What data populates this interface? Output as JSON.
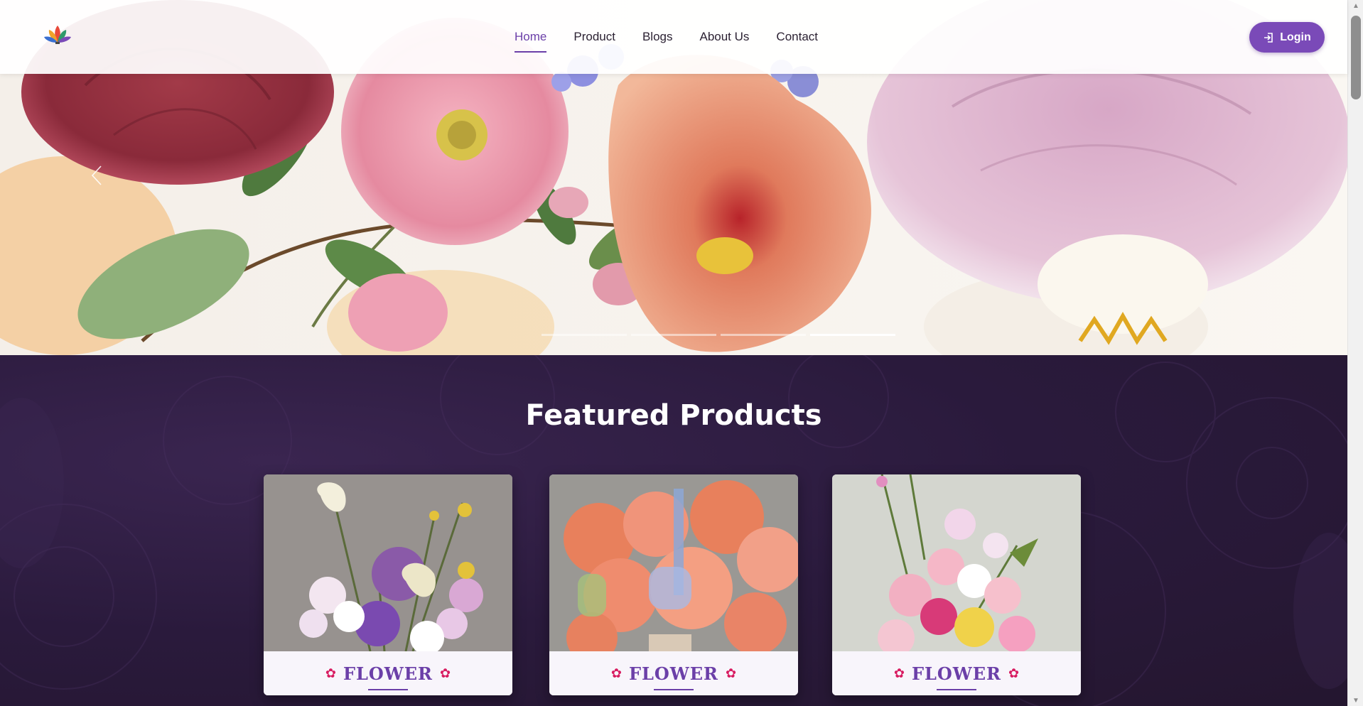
{
  "nav": {
    "items": [
      {
        "label": "Home",
        "active": true
      },
      {
        "label": "Product",
        "active": false
      },
      {
        "label": "Blogs",
        "active": false
      },
      {
        "label": "About Us",
        "active": false
      },
      {
        "label": "Contact",
        "active": false
      }
    ],
    "login_label": "Login"
  },
  "hero": {
    "prev_icon": "chevron-left-icon",
    "indicators": 3,
    "active_indicator": 3
  },
  "featured": {
    "title": "Featured Products",
    "products": [
      {
        "label": "FLOWER",
        "flower_glyph": "✿"
      },
      {
        "label": "FLOWER",
        "flower_glyph": "✿"
      },
      {
        "label": "FLOWER",
        "flower_glyph": "✿"
      }
    ]
  },
  "colors": {
    "accent": "#6b3fa8",
    "login_bg": "#7a4ab8",
    "section_bg": "#2a1a3c",
    "flower_glyph": "#d81b60"
  }
}
